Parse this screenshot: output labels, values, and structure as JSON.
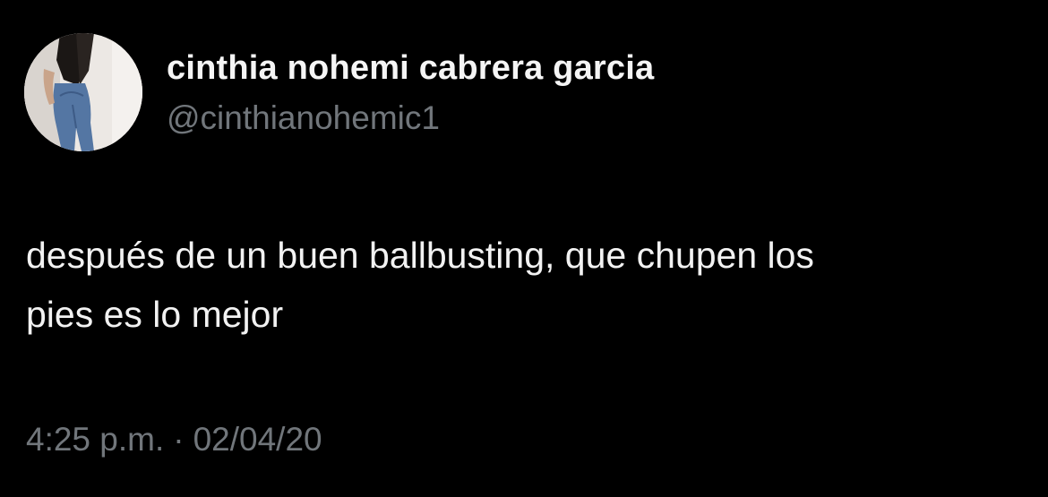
{
  "tweet": {
    "author": {
      "display_name": "cinthia nohemi cabrera garcia",
      "handle": "@cinthianohemic1"
    },
    "text_line1": "después de un buen ballbusting, que chupen los",
    "text_line2": "pies es lo mejor",
    "time": "4:25 p.m.",
    "separator": "·",
    "date": "02/04/20"
  },
  "colors": {
    "background": "#000000",
    "primary_text": "#f2f2f2",
    "secondary_text": "#71767b"
  }
}
